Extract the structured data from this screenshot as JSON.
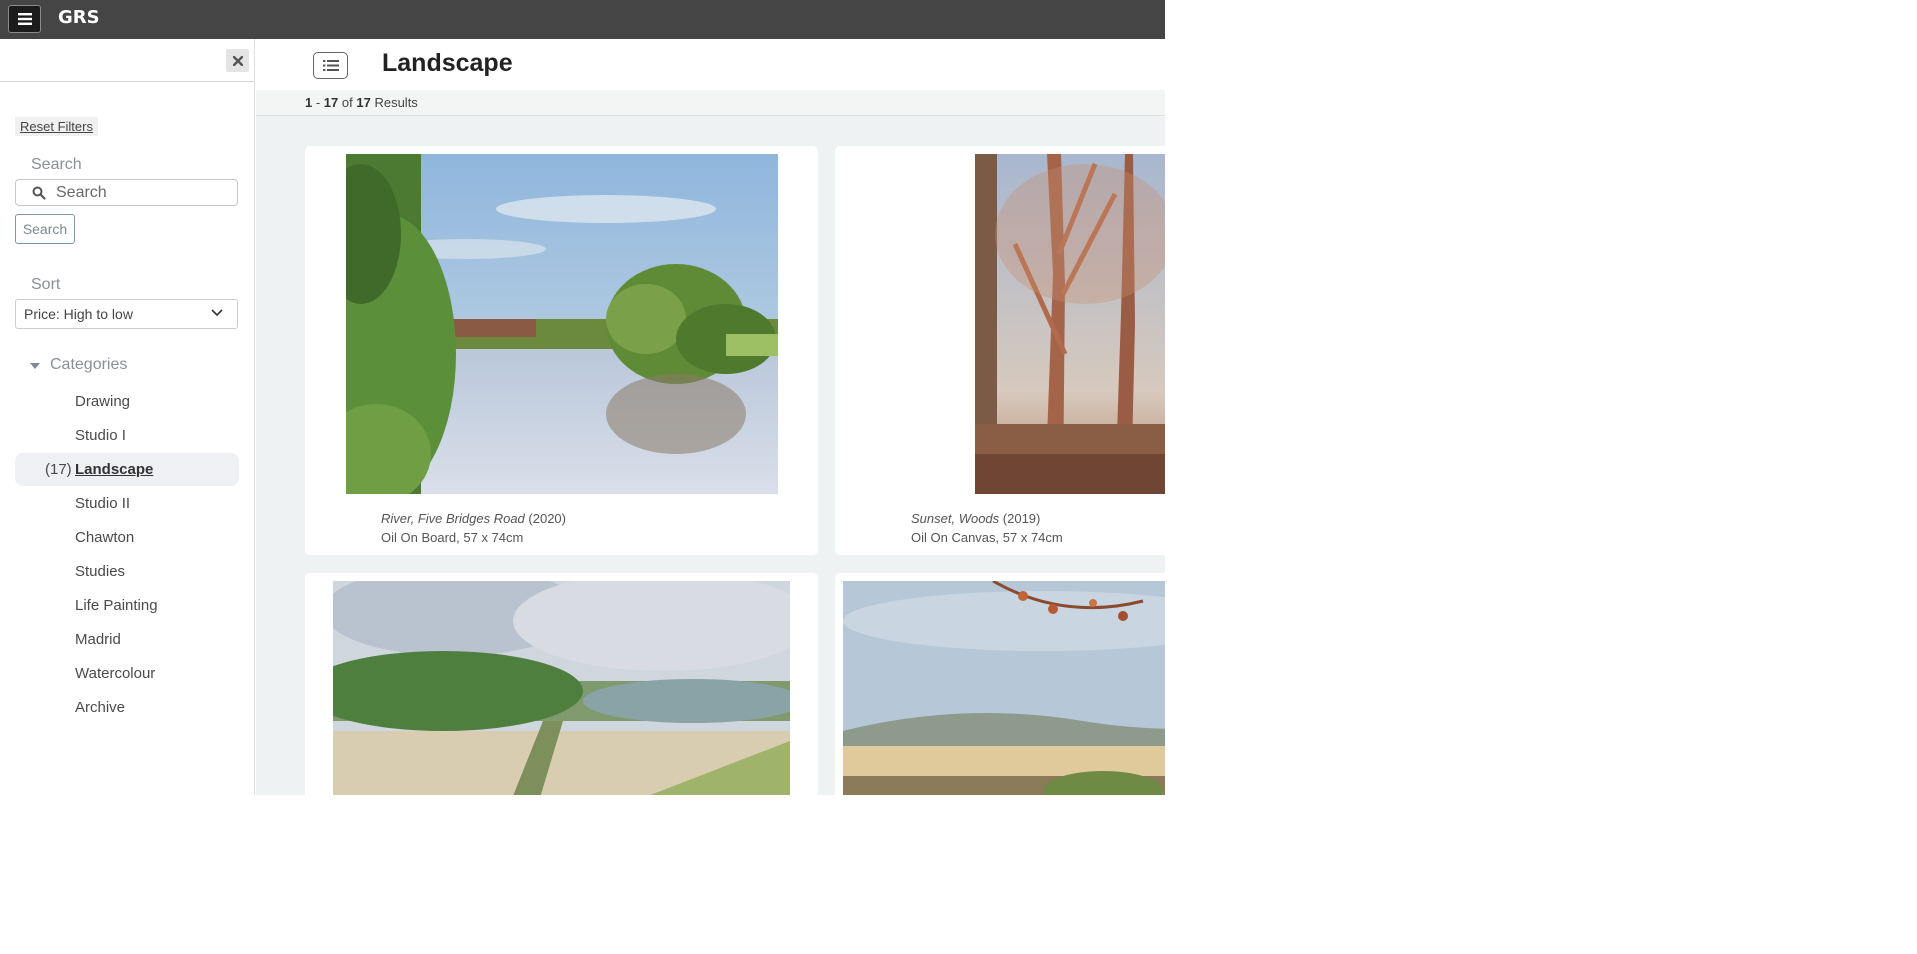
{
  "app": {
    "brand": "GRS"
  },
  "sidebar": {
    "reset_filters": "Reset Filters",
    "search_label": "Search",
    "search_placeholder": "Search",
    "search_button": "Search",
    "sort_label": "Sort",
    "sort_value": "Price: High to low",
    "categories_label": "Categories",
    "categories": [
      {
        "label": "Drawing"
      },
      {
        "label": "Studio I"
      },
      {
        "label": "Landscape",
        "count": "(17)",
        "active": true
      },
      {
        "label": "Studio II"
      },
      {
        "label": "Chawton"
      },
      {
        "label": "Studies"
      },
      {
        "label": "Life Painting"
      },
      {
        "label": "Madrid"
      },
      {
        "label": "Watercolour"
      },
      {
        "label": "Archive"
      }
    ]
  },
  "main": {
    "title": "Landscape",
    "results": {
      "from": "1",
      "to": "17",
      "of_word": "of",
      "total": "17",
      "suffix": "Results"
    },
    "cards": [
      {
        "title": "River, Five Bridges Road",
        "year": "(2020)",
        "medium": "Oil On Board, 57 x 74cm"
      },
      {
        "title": "Sunset, Woods",
        "year": "(2019)",
        "medium": "Oil On Canvas, 57 x 74cm"
      },
      {
        "title": "",
        "year": "",
        "medium": ""
      },
      {
        "title": "",
        "year": "",
        "medium": ""
      }
    ]
  },
  "colors": {
    "topbar": "#454545",
    "sidebar_active": "#eef0f3",
    "main_bg": "#eef2f2"
  }
}
